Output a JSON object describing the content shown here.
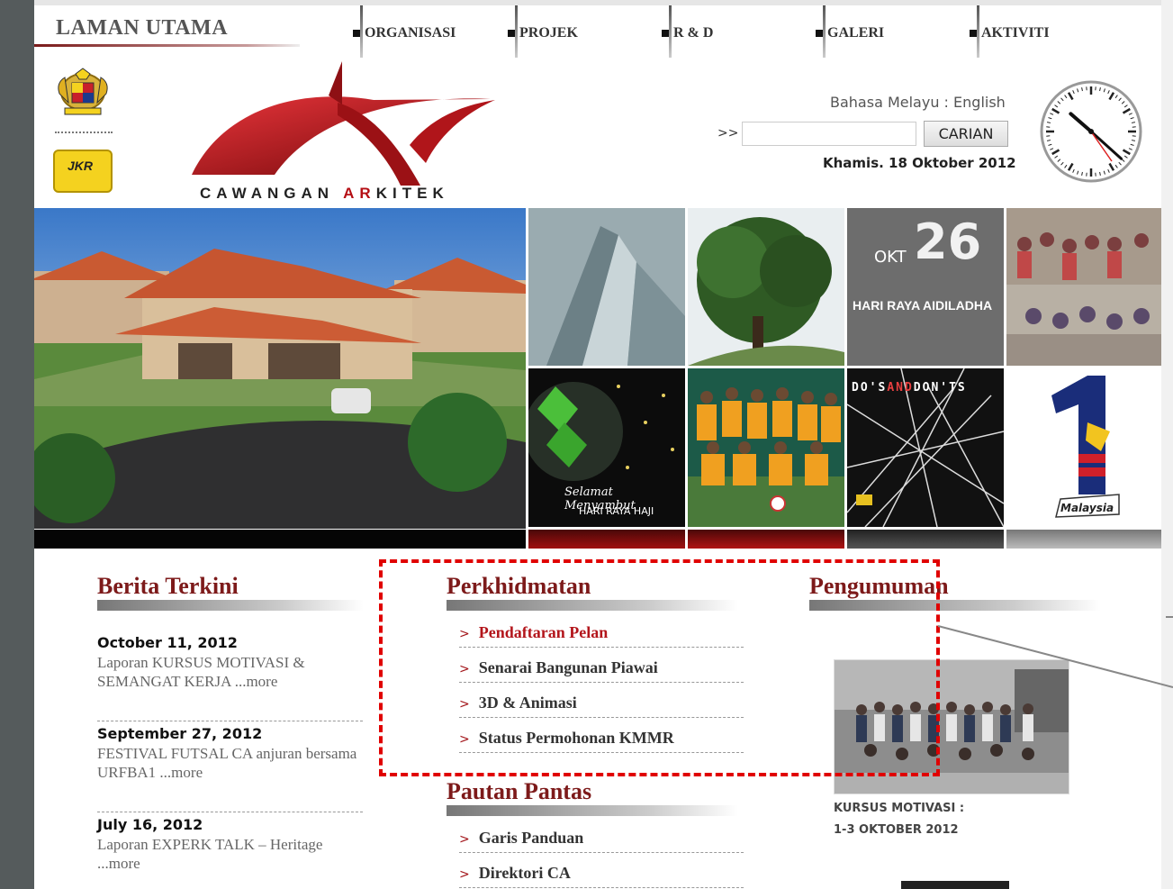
{
  "header": {
    "home_title": "LAMAN UTAMA",
    "nav": [
      "ORGANISASI",
      "PROJEK",
      "R & D",
      "GALERI",
      "AKTIVITI"
    ]
  },
  "logo": {
    "text_part1": "CAWANGAN ",
    "text_highlight": "AR",
    "text_part2": "KITEK"
  },
  "jkr_label": "JKR",
  "language": {
    "bm": "Bahasa Melayu",
    "separator": " : ",
    "en": "English"
  },
  "search": {
    "arrow": ">>",
    "placeholder": "",
    "button": "CARIAN"
  },
  "date_text": "Khamis. 18 Oktober 2012",
  "clock": {
    "hour": 10,
    "minute": 22
  },
  "tiles": {
    "okt": "OKT",
    "day": "26",
    "raya_haji": "HARI RAYA AIDILADHA",
    "salam_1": "Selamat Menyambut",
    "salam_2": "HARI RAYA HAJI",
    "dos": "DO'S",
    "and": "AND",
    "donts": "DON'TS",
    "malaysia": "Malaysia"
  },
  "berita": {
    "title": "Berita Terkini",
    "items": [
      {
        "date": "October 11, 2012",
        "text": "Laporan KURSUS MOTIVASI & SEMANGAT KERJA ...more"
      },
      {
        "date": "September 27, 2012",
        "text": "FESTIVAL FUTSAL CA anjuran bersama URFBA1 ...more"
      },
      {
        "date": "July 16, 2012",
        "text": "Laporan EXPERK TALK – Heritage ...more"
      }
    ]
  },
  "perkhidmatan": {
    "title": "Perkhidmatan",
    "chevron": ">",
    "items": [
      "Pendaftaran Pelan",
      "Senarai Bangunan Piawai",
      "3D & Animasi",
      "Status Permohonan KMMR"
    ]
  },
  "pautan": {
    "title": "Pautan Pantas",
    "items": [
      "Garis Panduan",
      "Direktori CA"
    ]
  },
  "pengumuman": {
    "title": "Pengumuman",
    "caption_1": "KURSUS MOTIVASI :",
    "caption_2": "1-3 OKTOBER 2012"
  },
  "colors": {
    "accent": "#7d1a1a",
    "highlight_box": "#e00000",
    "link_active": "#b3151b"
  }
}
